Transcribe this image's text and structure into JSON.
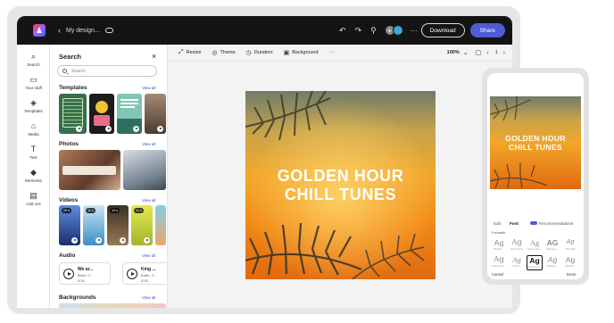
{
  "topbar": {
    "back_glyph": "‹",
    "title": "My design...",
    "undo": "↶",
    "redo": "↷",
    "pin": "⚲",
    "avatar_plus": "+",
    "more": "···",
    "download": "Download",
    "share": "Share"
  },
  "rail": {
    "items": [
      {
        "icon": "⌕",
        "label": "Search"
      },
      {
        "icon": "▭",
        "label": "Your stuff"
      },
      {
        "icon": "◈",
        "label": "Templates"
      },
      {
        "icon": "⌂",
        "label": "Media"
      },
      {
        "icon": "T",
        "label": "Text"
      },
      {
        "icon": "◆",
        "label": "Elements"
      },
      {
        "icon": "▤",
        "label": "Add ons"
      }
    ]
  },
  "panel": {
    "title": "Search",
    "close": "×",
    "search_placeholder": "Search",
    "sections": {
      "templates": {
        "title": "Templates",
        "view_all": "View all"
      },
      "photos": {
        "title": "Photos",
        "view_all": "View all"
      },
      "videos": {
        "title": "Videos",
        "view_all": "View all",
        "durations": [
          "20 s",
          "11 s",
          "10 s",
          "11 s"
        ]
      },
      "audio": {
        "title": "Audio",
        "view_all": "View all",
        "tracks": [
          {
            "title": "We ar...",
            "sub": "Bruci, C...",
            "duration": "4:20"
          },
          {
            "title": "King ...",
            "sub": "Earth, C...",
            "duration": "3:15"
          }
        ]
      },
      "backgrounds": {
        "title": "Backgrounds",
        "view_all": "View all"
      }
    }
  },
  "toolbar": {
    "resize": "Resize",
    "theme": "Theme",
    "duration": "Duration",
    "background": "Background",
    "more": "···",
    "zoom": "100%",
    "page": "1"
  },
  "artwork": {
    "line1": "GOLDEN HOUR",
    "line2": "CHILL TUNES"
  },
  "phone": {
    "tabs": {
      "edit": "Edit",
      "font": "Font",
      "recommendations": "Recommendations"
    },
    "section_label": "Fontastic",
    "fonts_row1": [
      {
        "sample": "Ag",
        "caption": "Bodoni..."
      },
      {
        "sample": "Ag",
        "caption": "Didot Sans"
      },
      {
        "sample": "Ag",
        "caption": "Source Ser..."
      },
      {
        "sample": "AG",
        "caption": "Alternate..."
      },
      {
        "sample": "Ag",
        "caption": "Thin light"
      }
    ],
    "fonts_row2": [
      {
        "sample": "Ag",
        "caption": "Classic Ser..."
      },
      {
        "sample": "Ag",
        "caption": "Script..."
      },
      {
        "sample": "Ag",
        "caption": "Montserrat..."
      },
      {
        "sample": "Ag",
        "caption": "Elegant..."
      },
      {
        "sample": "Ag",
        "caption": "Modern..."
      }
    ],
    "cancel": "Cancel",
    "done": "Done"
  },
  "colors": {
    "topbar": "#141414",
    "accent": "#4f5bd5",
    "link": "#3d4fc4"
  }
}
